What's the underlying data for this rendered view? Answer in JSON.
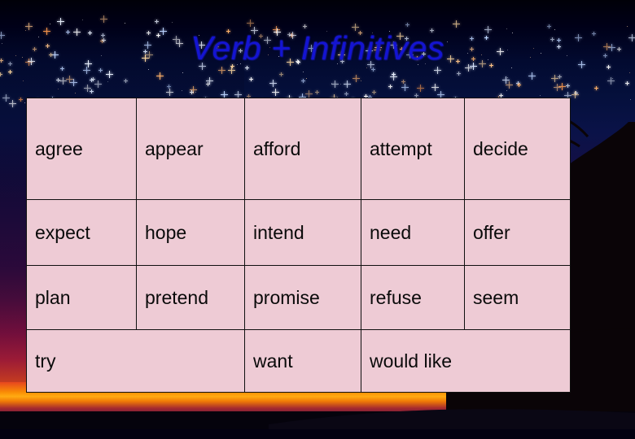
{
  "slide": {
    "title": "Verb + Infinitives",
    "title_color": "#1414d2",
    "table_fill": "#eecbd5",
    "table_border": "#101010"
  },
  "table": {
    "rows": [
      {
        "cells": [
          {
            "text": "agree"
          },
          {
            "text": "appear"
          },
          {
            "text": "afford"
          },
          {
            "text": "attempt"
          },
          {
            "text": "decide"
          }
        ]
      },
      {
        "cells": [
          {
            "text": "expect"
          },
          {
            "text": "hope"
          },
          {
            "text": "intend"
          },
          {
            "text": "need"
          },
          {
            "text": "offer"
          }
        ]
      },
      {
        "cells": [
          {
            "text": "plan"
          },
          {
            "text": "pretend"
          },
          {
            "text": "promise"
          },
          {
            "text": "refuse"
          },
          {
            "text": "seem"
          }
        ]
      },
      {
        "cells": [
          {
            "text": "try"
          },
          {
            "text": "want"
          },
          {
            "text": "would like"
          }
        ]
      }
    ]
  }
}
